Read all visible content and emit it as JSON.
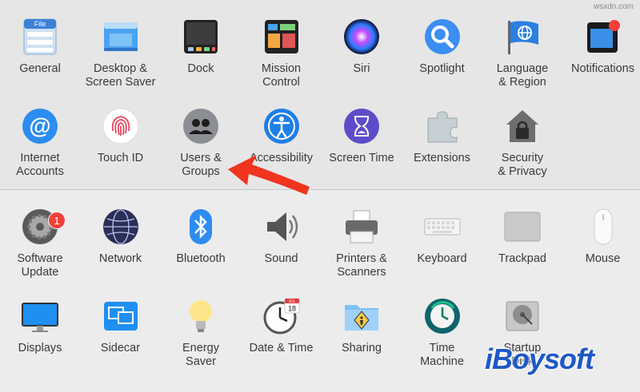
{
  "sections": [
    {
      "rows": [
        [
          {
            "id": "general",
            "label": "General",
            "icon": "general-icon"
          },
          {
            "id": "desktop-screen-saver",
            "label": "Desktop &\nScreen Saver",
            "icon": "desktop-icon"
          },
          {
            "id": "dock",
            "label": "Dock",
            "icon": "dock-icon"
          },
          {
            "id": "mission-control",
            "label": "Mission\nControl",
            "icon": "mission-control-icon"
          },
          {
            "id": "siri",
            "label": "Siri",
            "icon": "siri-icon"
          },
          {
            "id": "spotlight",
            "label": "Spotlight",
            "icon": "spotlight-icon"
          },
          {
            "id": "language-region",
            "label": "Language\n& Region",
            "icon": "language-flag-icon"
          },
          {
            "id": "notifications",
            "label": "Notifications",
            "icon": "notifications-icon"
          }
        ],
        [
          {
            "id": "internet-accounts",
            "label": "Internet\nAccounts",
            "icon": "at-sign-icon"
          },
          {
            "id": "touch-id",
            "label": "Touch ID",
            "icon": "fingerprint-icon"
          },
          {
            "id": "users-groups",
            "label": "Users &\nGroups",
            "icon": "users-icon"
          },
          {
            "id": "accessibility",
            "label": "Accessibility",
            "icon": "accessibility-icon"
          },
          {
            "id": "screen-time",
            "label": "Screen Time",
            "icon": "hourglass-icon"
          },
          {
            "id": "extensions",
            "label": "Extensions",
            "icon": "puzzle-icon"
          },
          {
            "id": "security-privacy",
            "label": "Security\n& Privacy",
            "icon": "house-lock-icon"
          }
        ]
      ]
    },
    {
      "rows": [
        [
          {
            "id": "software-update",
            "label": "Software\nUpdate",
            "icon": "gear-icon",
            "badge": "1"
          },
          {
            "id": "network",
            "label": "Network",
            "icon": "globe-icon"
          },
          {
            "id": "bluetooth",
            "label": "Bluetooth",
            "icon": "bluetooth-icon"
          },
          {
            "id": "sound",
            "label": "Sound",
            "icon": "speaker-icon"
          },
          {
            "id": "printers-scanners",
            "label": "Printers &\nScanners",
            "icon": "printer-icon"
          },
          {
            "id": "keyboard",
            "label": "Keyboard",
            "icon": "keyboard-icon"
          },
          {
            "id": "trackpad",
            "label": "Trackpad",
            "icon": "trackpad-icon"
          },
          {
            "id": "mouse",
            "label": "Mouse",
            "icon": "mouse-icon"
          }
        ],
        [
          {
            "id": "displays",
            "label": "Displays",
            "icon": "display-icon"
          },
          {
            "id": "sidecar",
            "label": "Sidecar",
            "icon": "sidecar-icon"
          },
          {
            "id": "energy-saver",
            "label": "Energy\nSaver",
            "icon": "lightbulb-icon"
          },
          {
            "id": "date-time",
            "label": "Date & Time",
            "icon": "clock-icon"
          },
          {
            "id": "sharing",
            "label": "Sharing",
            "icon": "sharing-folder-icon"
          },
          {
            "id": "time-machine",
            "label": "Time\nMachine",
            "icon": "time-machine-icon"
          },
          {
            "id": "startup-disk",
            "label": "Startup\nDisk",
            "icon": "disk-icon"
          }
        ]
      ]
    }
  ],
  "calendar_icon_text": {
    "month": "JUL",
    "day": "18"
  },
  "watermark": "iBoysoft",
  "site_credit": "wsxdn.com",
  "colors": {
    "accent": "#1d7bf2",
    "arrow": "#f0341f",
    "badge": "#f2403a",
    "watermark": "#1e58c7"
  }
}
